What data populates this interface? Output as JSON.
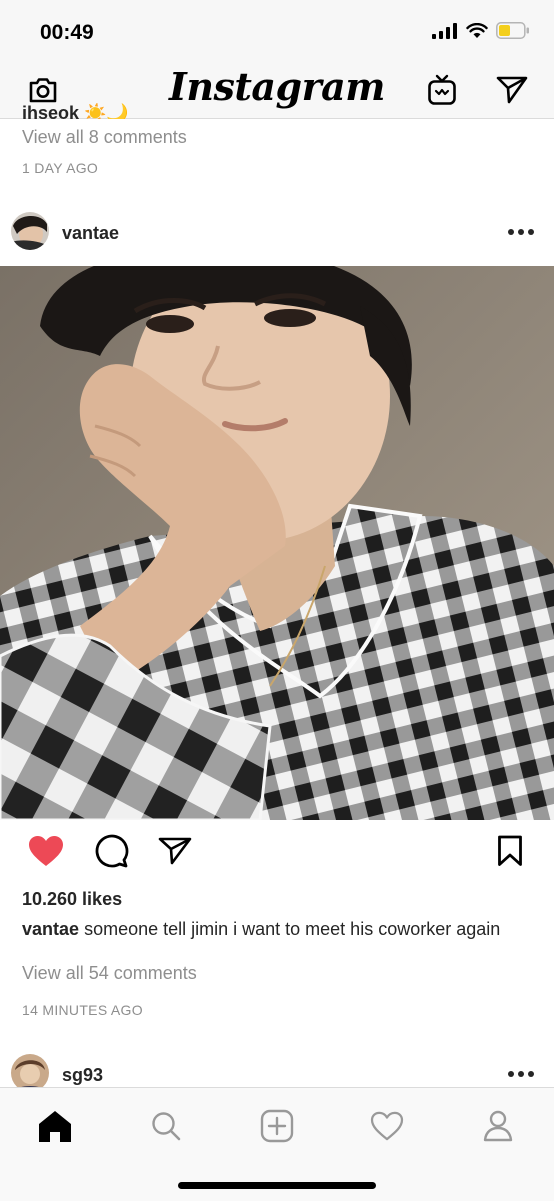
{
  "status_bar": {
    "time": "00:49"
  },
  "nav": {
    "logo": "Instagram"
  },
  "previous_post": {
    "caption_fragment": "jhseok ☀️🌙",
    "view_comments": "View all 8 comments",
    "time_ago": "1 DAY AGO"
  },
  "post": {
    "username": "vantae",
    "likes": "10.260 likes",
    "caption_user": "vantae",
    "caption_text": "someone tell jimin i want to meet his coworker again",
    "view_comments": "View all 54 comments",
    "time_ago": "14 MINUTES AGO",
    "liked": true
  },
  "next_post": {
    "username": "sg93"
  },
  "colors": {
    "like_red": "#ed4956",
    "text": "#262626",
    "secondary_text": "#8e8e8e",
    "battery": "#f4cf1c"
  },
  "icons": {
    "nav": [
      "camera-icon",
      "igtv-icon",
      "direct-message-icon"
    ],
    "actions": [
      "heart-icon",
      "comment-icon",
      "share-icon",
      "bookmark-icon"
    ],
    "tabs": [
      "home-icon",
      "search-icon",
      "add-post-icon",
      "activity-heart-icon",
      "profile-icon"
    ]
  }
}
